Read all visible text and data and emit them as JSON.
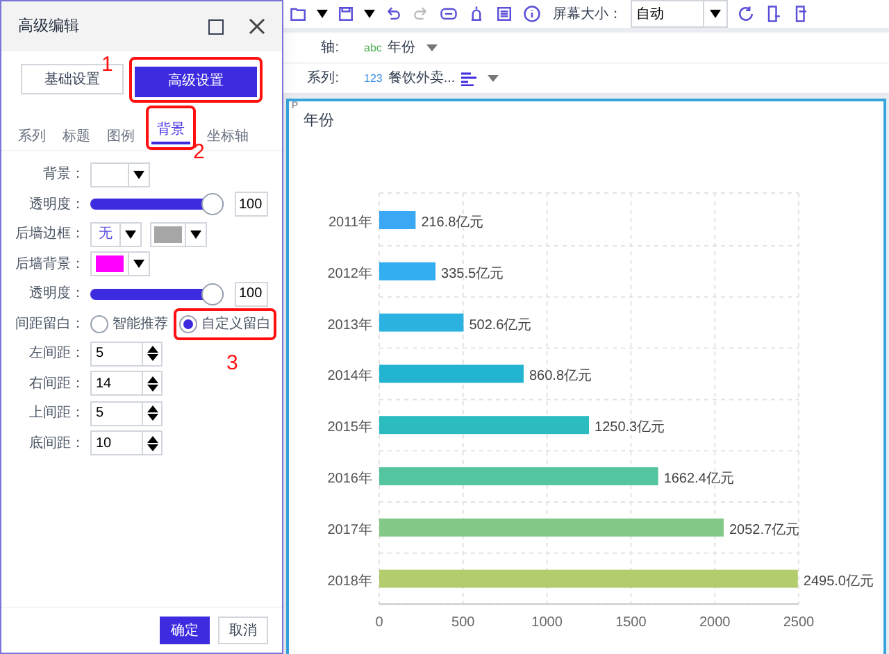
{
  "dialog": {
    "title": "高级编辑",
    "modes": [
      {
        "label": "基础设置",
        "selected": false
      },
      {
        "label": "高级设置",
        "selected": true,
        "callout": "1"
      }
    ],
    "tabs": [
      {
        "label": "系列",
        "selected": false
      },
      {
        "label": "标题",
        "selected": false
      },
      {
        "label": "图例",
        "selected": false
      },
      {
        "label": "背景",
        "selected": true,
        "callout": "2"
      },
      {
        "label": "坐标轴",
        "selected": false
      }
    ],
    "rows": [
      {
        "kind": "color",
        "label": "背景："
      },
      {
        "kind": "slider",
        "label": "透明度：",
        "level": 1,
        "value": "100"
      },
      {
        "kind": "border",
        "label": "后墙边框：",
        "value": "无",
        "color": "#a6a6a6"
      },
      {
        "kind": "color",
        "label": "后墙背景：",
        "color": "#ff00ff"
      },
      {
        "kind": "slider",
        "label": "透明度：",
        "level": 1,
        "value": "100"
      },
      {
        "kind": "radio",
        "label": "间距留白：",
        "options": [
          {
            "label": "智能推荐",
            "selected": false
          },
          {
            "label": "自定义留白",
            "selected": true,
            "callout": "3"
          }
        ]
      },
      {
        "kind": "spinner",
        "label": "左间距：",
        "value": "5"
      },
      {
        "kind": "spinner",
        "label": "右间距：",
        "value": "14"
      },
      {
        "kind": "spinner",
        "label": "上间距：",
        "value": "5"
      },
      {
        "kind": "spinner",
        "label": "底间距：",
        "value": "10"
      }
    ],
    "buttons": [
      {
        "label": "确定",
        "primary": true
      },
      {
        "label": "取消",
        "primary": false
      }
    ]
  },
  "toolbar": {
    "screen_size_label": "屏幕大小：",
    "screen_size_value": "自动"
  },
  "fields": [
    {
      "label": "轴:",
      "type_tag": "abc",
      "value": "年份"
    },
    {
      "label": "系列:",
      "type_tag": "123",
      "value": "餐饮外卖..."
    }
  ],
  "chart": {
    "corner_mark": "P",
    "title": "年份",
    "chart_data": {
      "type": "bar",
      "orientation": "horizontal",
      "categories": [
        "2011年",
        "2012年",
        "2013年",
        "2014年",
        "2015年",
        "2016年",
        "2017年",
        "2018年"
      ],
      "series": [
        {
          "values": [
            216.8,
            335.5,
            502.6,
            860.8,
            1250.3,
            1662.4,
            2052.7,
            2495.0
          ]
        }
      ],
      "colors": [
        "#3aa8f5",
        "#33aef0",
        "#2cb2e0",
        "#22b4d0",
        "#2cbcc0",
        "#55c4a0",
        "#84c888",
        "#b2cc6e"
      ],
      "xlim": [
        0,
        2500
      ],
      "xticks": [
        0,
        500,
        1000,
        1500,
        2000,
        2500
      ],
      "grid": true,
      "value_labels": [
        "216.8亿元",
        "335.5亿元",
        "502.6亿元",
        "860.8亿元",
        "1250.3亿元",
        "1662.4亿元",
        "2052.7亿元",
        "2495.0亿元"
      ]
    }
  }
}
